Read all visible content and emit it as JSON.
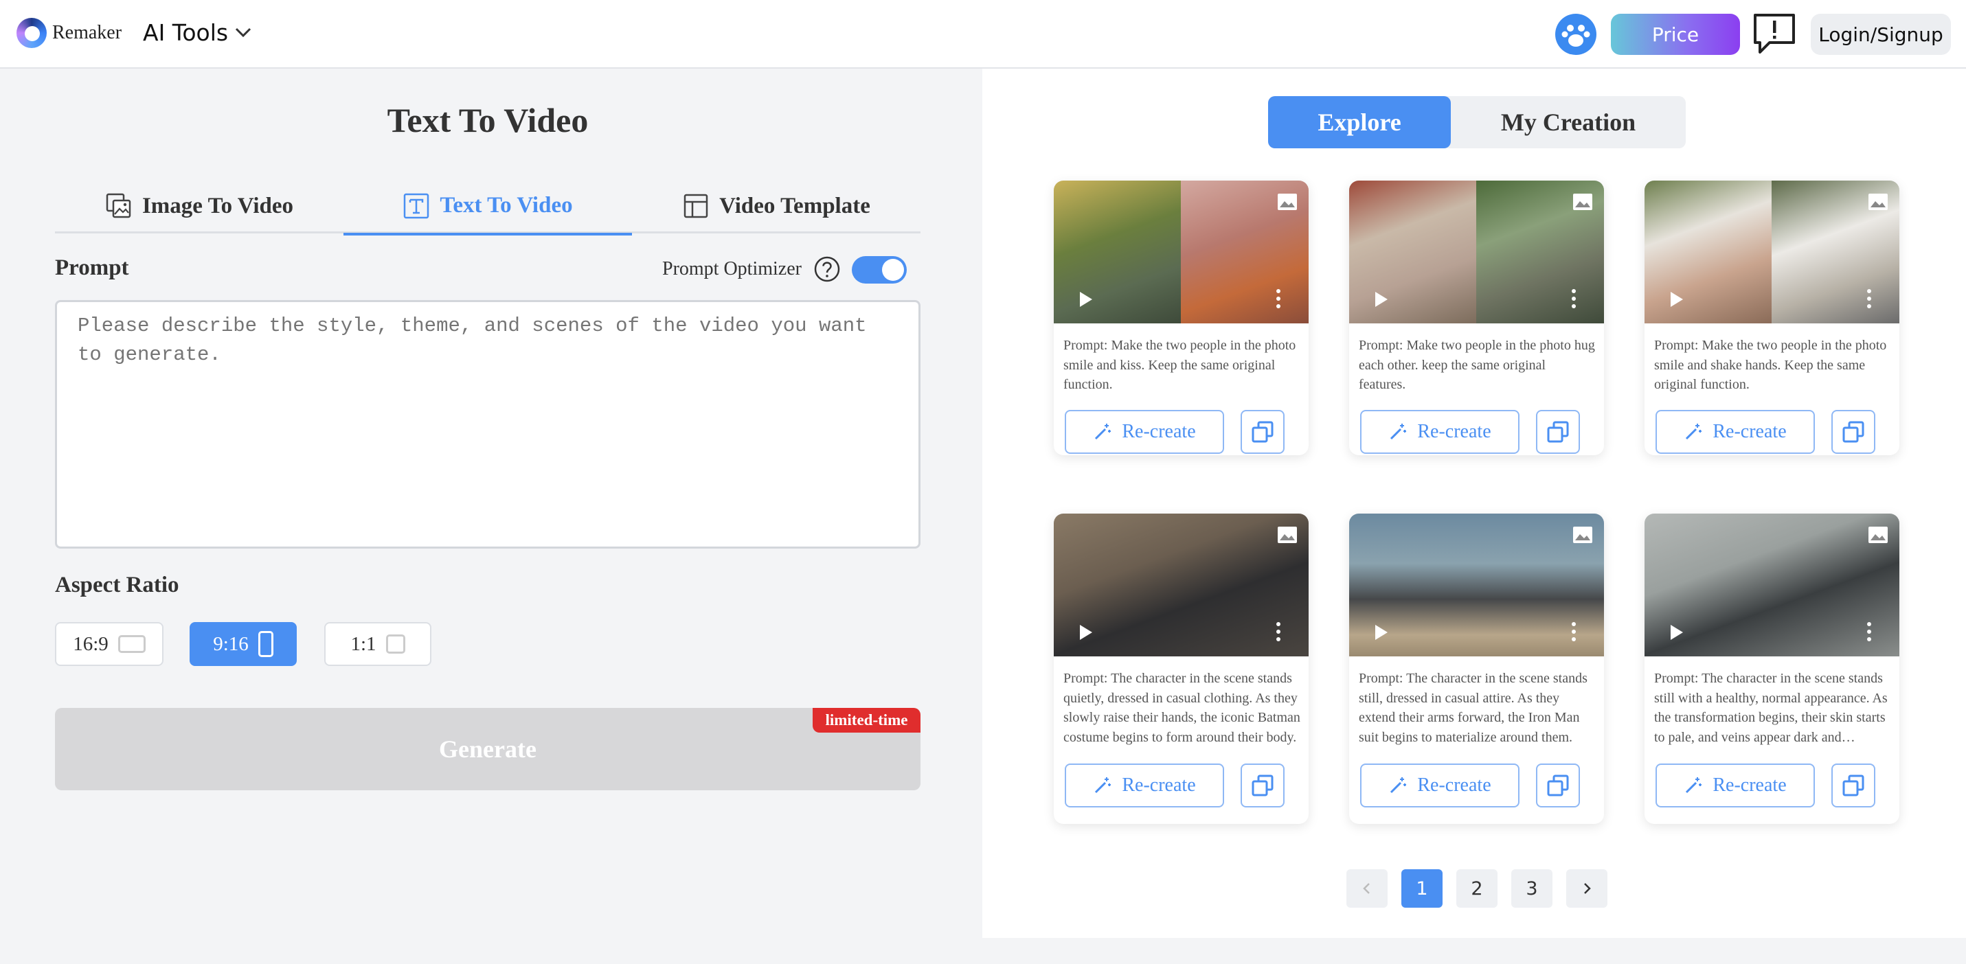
{
  "header": {
    "brand": "Remaker",
    "tools_label": "AI Tools",
    "price_label": "Price",
    "login_label": "Login/Signup"
  },
  "left": {
    "title": "Text To Video",
    "tabs": [
      {
        "label": "Image To Video",
        "icon": "image-stack-icon",
        "active": false
      },
      {
        "label": "Text To Video",
        "icon": "text-box-icon",
        "active": true
      },
      {
        "label": "Video Template",
        "icon": "template-icon",
        "active": false
      }
    ],
    "prompt_label": "Prompt",
    "optimizer_label": "Prompt Optimizer",
    "optimizer_on": true,
    "prompt_placeholder": "Please describe the style, theme, and scenes of the video you want to generate.",
    "aspect_label": "Aspect Ratio",
    "ratios": [
      {
        "label": "16:9",
        "active": false
      },
      {
        "label": "9:16",
        "active": true
      },
      {
        "label": "1:1",
        "active": false
      }
    ],
    "generate_label": "Generate",
    "badge": "limited-time"
  },
  "right": {
    "tabs": [
      {
        "label": "Explore",
        "active": true
      },
      {
        "label": "My Creation",
        "active": false
      }
    ],
    "cards": [
      {
        "prompt": "Prompt: Make the two people in the photo smile and kiss. Keep the same original function.",
        "button": "Re-create"
      },
      {
        "prompt": "Prompt: Make two people in the photo hug each other. keep the same original features.",
        "button": "Re-create"
      },
      {
        "prompt": "Prompt: Make the two people in the photo smile and shake hands. Keep the same original function.",
        "button": "Re-create"
      },
      {
        "prompt": "Prompt: The character in the scene stands quietly, dressed in casual clothing. As they slowly raise their hands, the iconic Batman costume begins to form around their body.",
        "button": "Re-create"
      },
      {
        "prompt": "Prompt: The character in the scene stands still, dressed in casual attire. As they extend their arms forward, the Iron Man suit begins to materialize around them.",
        "button": "Re-create"
      },
      {
        "prompt": "Prompt: The character in the scene stands still with a healthy, normal appearance. As the transformation begins, their skin starts to pale, and veins appear dark and prominent.",
        "button": "Re-create"
      }
    ],
    "pages": [
      "1",
      "2",
      "3"
    ],
    "current_page": "1"
  },
  "colors": {
    "accent": "#4a8ff2",
    "badge": "#e02d2d",
    "generate_disabled": "#d7d7d9"
  }
}
